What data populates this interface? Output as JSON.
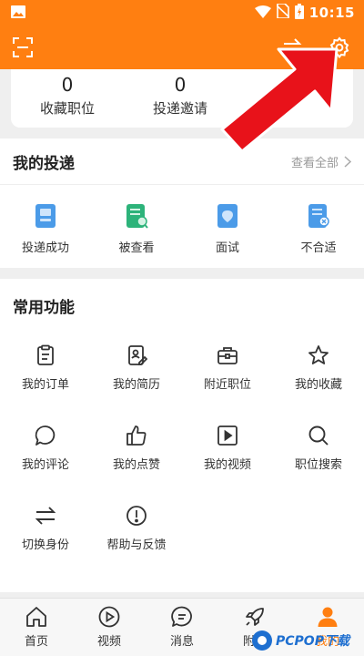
{
  "colors": {
    "brand": "#ff7f11",
    "icon_blue": "#4b9be8",
    "icon_green": "#2db37a",
    "icon_red": "#e53935"
  },
  "status_bar": {
    "time": "10:15",
    "icons": [
      "image-icon",
      "wifi-icon",
      "no-sim-icon",
      "battery-icon"
    ]
  },
  "toolbar": {
    "icons": [
      "scan-icon",
      "switch-icon",
      "settings-icon"
    ]
  },
  "stats": [
    {
      "count": "0",
      "label": "收藏职位"
    },
    {
      "count": "0",
      "label": "投递邀请"
    }
  ],
  "delivery": {
    "title": "我的投递",
    "view_all": "查看全部",
    "items": [
      {
        "label": "投递成功",
        "icon": "delivered-icon"
      },
      {
        "label": "被查看",
        "icon": "viewed-icon"
      },
      {
        "label": "面试",
        "icon": "interview-icon"
      },
      {
        "label": "不合适",
        "icon": "unsuitable-icon"
      }
    ]
  },
  "functions": {
    "title": "常用功能",
    "items": [
      {
        "label": "我的订单",
        "icon": "order-icon"
      },
      {
        "label": "我的简历",
        "icon": "resume-icon"
      },
      {
        "label": "附近职位",
        "icon": "briefcase-icon"
      },
      {
        "label": "我的收藏",
        "icon": "star-icon"
      },
      {
        "label": "我的评论",
        "icon": "comment-icon"
      },
      {
        "label": "我的点赞",
        "icon": "thumbs-up-icon"
      },
      {
        "label": "我的视频",
        "icon": "video-icon"
      },
      {
        "label": "职位搜索",
        "icon": "search-icon"
      },
      {
        "label": "切换身份",
        "icon": "switch-icon"
      },
      {
        "label": "帮助与反馈",
        "icon": "help-icon"
      }
    ]
  },
  "tabbar": {
    "items": [
      {
        "label": "首页",
        "icon": "home-icon"
      },
      {
        "label": "视频",
        "icon": "play-icon"
      },
      {
        "label": "消息",
        "icon": "message-icon"
      },
      {
        "label": "附近",
        "icon": "rocket-icon"
      },
      {
        "label": "我的",
        "icon": "profile-icon",
        "active": true
      }
    ]
  },
  "watermark": {
    "text": "PCPOP下载"
  }
}
